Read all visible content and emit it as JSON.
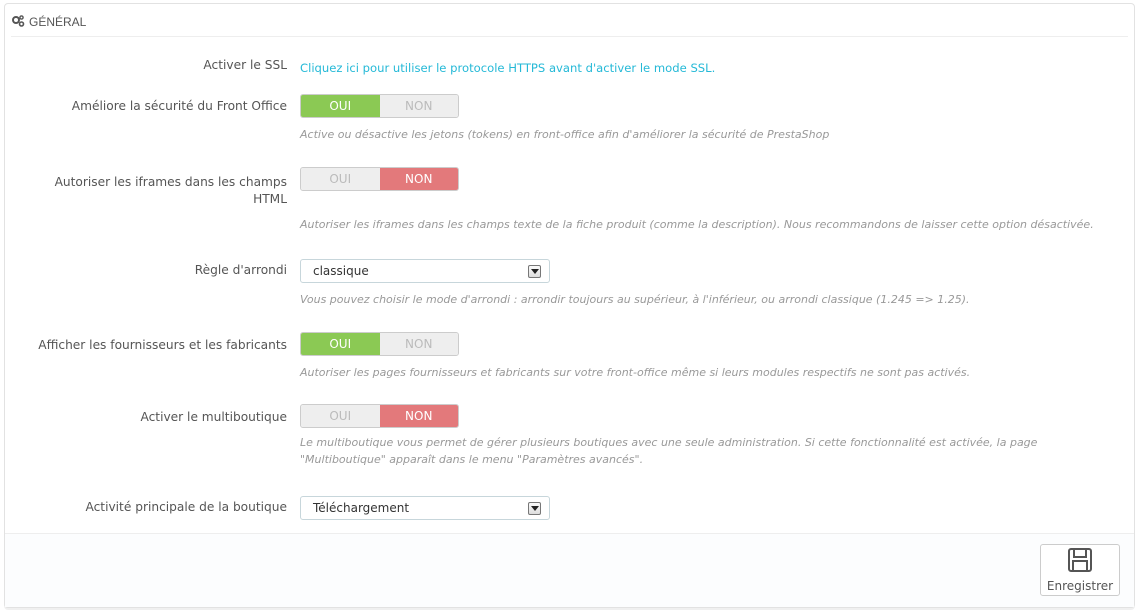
{
  "panel": {
    "title": "Général",
    "icon": "gears-icon"
  },
  "fields": {
    "ssl": {
      "label": "Activer le SSL",
      "link_text": "Cliquez ici pour utiliser le protocole HTTPS avant d'activer le mode SSL."
    },
    "front_security": {
      "label": "Améliore la sécurité du Front Office",
      "yes": "OUI",
      "no": "NON",
      "selected": "OUI",
      "help": "Active ou désactive les jetons (tokens) en front-office afin d'améliorer la sécurité de PrestaShop"
    },
    "iframes": {
      "label": "Autoriser les iframes dans les champs HTML",
      "yes": "OUI",
      "no": "NON",
      "selected": "NON",
      "help": "Autoriser les iframes dans les champs texte de la fiche produit (comme la description). Nous recommandons de laisser cette option désactivée."
    },
    "rounding": {
      "label": "Règle d'arrondi",
      "value": "classique",
      "help": "Vous pouvez choisir le mode d'arrondi : arrondir toujours au supérieur, à l'inférieur, ou arrondi classique (1.245 => 1.25)."
    },
    "suppliers": {
      "label": "Afficher les fournisseurs et les fabricants",
      "yes": "OUI",
      "no": "NON",
      "selected": "OUI",
      "help": "Autoriser les pages fournisseurs et fabricants sur votre front-office même si leurs modules respectifs ne sont pas activés."
    },
    "multishop": {
      "label": "Activer le multiboutique",
      "yes": "OUI",
      "no": "NON",
      "selected": "NON",
      "help_line1": "Le multiboutique vous permet de gérer plusieurs boutiques avec une seule administration. Si cette fonctionnalité est activée, la page",
      "help_line2": "\"Multiboutique\" apparaît dans le menu \"Paramètres avancés\"."
    },
    "activity": {
      "label": "Activité principale de la boutique",
      "value": "Téléchargement"
    }
  },
  "footer": {
    "save_label": "Enregistrer",
    "save_icon": "save-icon"
  },
  "colors": {
    "yes_active": "#8bc954",
    "no_active": "#e3797b",
    "link": "#25b9d7",
    "help_text": "#999999"
  }
}
